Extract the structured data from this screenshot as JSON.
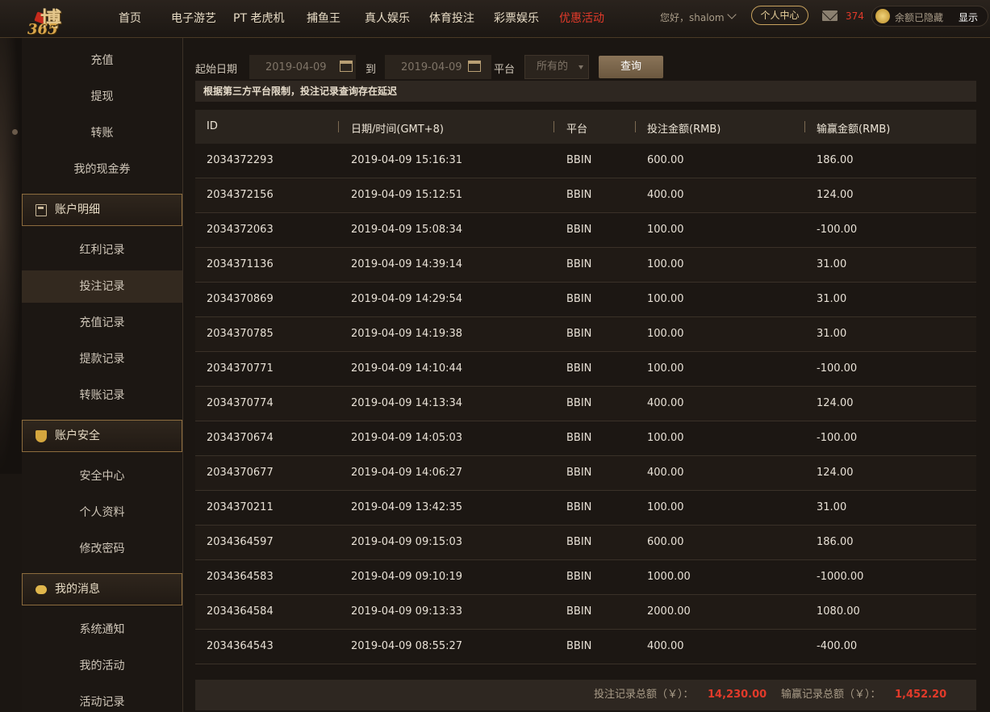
{
  "header": {
    "logo_text_1": "博",
    "logo_text_2": "365",
    "nav": [
      {
        "label": "首页"
      },
      {
        "label": "电子游艺"
      },
      {
        "label": "PT 老虎机"
      },
      {
        "label": "捕鱼王"
      },
      {
        "label": "真人娱乐"
      },
      {
        "label": "体育投注"
      },
      {
        "label": "彩票娱乐"
      },
      {
        "label": "优惠活动"
      }
    ],
    "greeting": "您好，shalom",
    "personal_center": "个人中心",
    "mail_count": "374",
    "balance_hidden": "余额已隐藏",
    "show_label": "显示"
  },
  "sidebar": {
    "group1": [
      "充值",
      "提现",
      "转账",
      "我的现金券"
    ],
    "account_details_header": "账户明细",
    "group2": [
      "红利记录",
      "投注记录",
      "充值记录",
      "提款记录",
      "转账记录"
    ],
    "account_security_header": "账户安全",
    "group3": [
      "安全中心",
      "个人资料",
      "修改密码"
    ],
    "my_messages_header": "我的消息",
    "group4": [
      "系统通知",
      "我的活动",
      "活动记录"
    ]
  },
  "filter": {
    "start_label": "起始日期",
    "start_date": "2019-04-09",
    "to_label": "到",
    "end_date": "2019-04-09",
    "platform_label": "平台",
    "platform_value": "所有的",
    "query_button": "查询"
  },
  "notice": "根据第三方平台限制，投注记录查询存在延迟",
  "table": {
    "headers": [
      "ID",
      "日期/时间(GMT+8)",
      "平台",
      "投注金额(RMB)",
      "输赢金额(RMB)"
    ],
    "rows": [
      [
        "2034372293",
        "2019-04-09 15:16:31",
        "BBIN",
        "600.00",
        "186.00"
      ],
      [
        "2034372156",
        "2019-04-09 15:12:51",
        "BBIN",
        "400.00",
        "124.00"
      ],
      [
        "2034372063",
        "2019-04-09 15:08:34",
        "BBIN",
        "100.00",
        "-100.00"
      ],
      [
        "2034371136",
        "2019-04-09 14:39:14",
        "BBIN",
        "100.00",
        "31.00"
      ],
      [
        "2034370869",
        "2019-04-09 14:29:54",
        "BBIN",
        "100.00",
        "31.00"
      ],
      [
        "2034370785",
        "2019-04-09 14:19:38",
        "BBIN",
        "100.00",
        "31.00"
      ],
      [
        "2034370771",
        "2019-04-09 14:10:44",
        "BBIN",
        "100.00",
        "-100.00"
      ],
      [
        "2034370774",
        "2019-04-09 14:13:34",
        "BBIN",
        "400.00",
        "124.00"
      ],
      [
        "2034370674",
        "2019-04-09 14:05:03",
        "BBIN",
        "100.00",
        "-100.00"
      ],
      [
        "2034370677",
        "2019-04-09 14:06:27",
        "BBIN",
        "400.00",
        "124.00"
      ],
      [
        "2034370211",
        "2019-04-09 13:42:35",
        "BBIN",
        "100.00",
        "31.00"
      ],
      [
        "2034364597",
        "2019-04-09 09:15:03",
        "BBIN",
        "600.00",
        "186.00"
      ],
      [
        "2034364583",
        "2019-04-09 09:10:19",
        "BBIN",
        "1000.00",
        "-1000.00"
      ],
      [
        "2034364584",
        "2019-04-09 09:13:33",
        "BBIN",
        "2000.00",
        "1080.00"
      ],
      [
        "2034364543",
        "2019-04-09 08:55:27",
        "BBIN",
        "400.00",
        "-400.00"
      ]
    ]
  },
  "summary": {
    "bet_total_label": "投注记录总额（￥）：",
    "bet_total_value": "14,230.00",
    "win_total_label": "输赢记录总额（￥）：",
    "win_total_value": "1,452.20"
  },
  "colors": {
    "accent_red": "#e23a2a",
    "gold": "#c9a35e",
    "background": "#1b1612"
  }
}
